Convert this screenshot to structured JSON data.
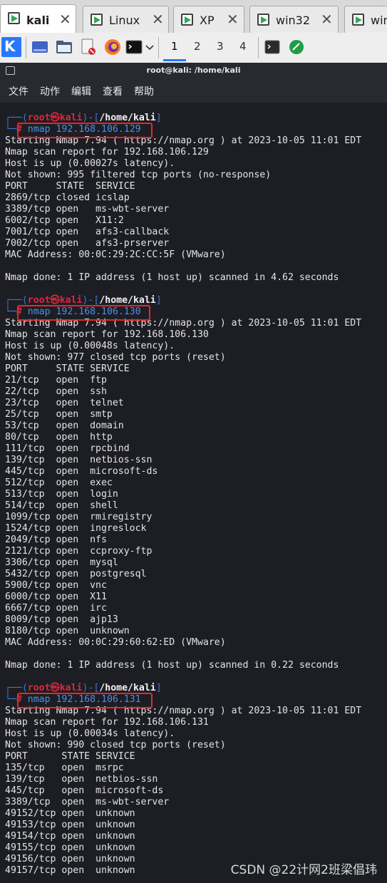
{
  "tabs": [
    {
      "label": "kali",
      "close": "✕",
      "active": true
    },
    {
      "label": "Linux",
      "close": "✕",
      "active": false
    },
    {
      "label": "XP",
      "close": "✕",
      "active": false
    },
    {
      "label": "win32",
      "close": "✕",
      "active": false
    },
    {
      "label": "win",
      "close": "",
      "active": false
    }
  ],
  "panel": {
    "workspaces": [
      "1",
      "2",
      "3",
      "4"
    ],
    "active_workspace": "1"
  },
  "terminal": {
    "title": "root@kali: /home/kali",
    "menu": [
      "文件",
      "动作",
      "编辑",
      "查看",
      "帮助"
    ]
  },
  "prompt": {
    "open": "┌──(",
    "user": "root㉿kali",
    "mid": ")-[",
    "path": "/home/kali",
    "close": "]",
    "second": "└─",
    "hash": "#"
  },
  "scans": [
    {
      "command": "nmap 192.168.106.129",
      "output": [
        "Starting Nmap 7.94 ( https://nmap.org ) at 2023-10-05 11:01 EDT",
        "Nmap scan report for 192.168.106.129",
        "Host is up (0.00027s latency).",
        "Not shown: 995 filtered tcp ports (no-response)",
        "PORT     STATE  SERVICE",
        "2869/tcp closed icslap",
        "3389/tcp open   ms-wbt-server",
        "6002/tcp open   X11:2",
        "7001/tcp open   afs3-callback",
        "7002/tcp open   afs3-prserver",
        "MAC Address: 00:0C:29:2C:CC:5F (VMware)",
        "",
        "Nmap done: 1 IP address (1 host up) scanned in 4.62 seconds"
      ]
    },
    {
      "command": "nmap 192.168.106.130",
      "output": [
        "Starting Nmap 7.94 ( https://nmap.org ) at 2023-10-05 11:01 EDT",
        "Nmap scan report for 192.168.106.130",
        "Host is up (0.00048s latency).",
        "Not shown: 977 closed tcp ports (reset)",
        "PORT     STATE SERVICE",
        "21/tcp   open  ftp",
        "22/tcp   open  ssh",
        "23/tcp   open  telnet",
        "25/tcp   open  smtp",
        "53/tcp   open  domain",
        "80/tcp   open  http",
        "111/tcp  open  rpcbind",
        "139/tcp  open  netbios-ssn",
        "445/tcp  open  microsoft-ds",
        "512/tcp  open  exec",
        "513/tcp  open  login",
        "514/tcp  open  shell",
        "1099/tcp open  rmiregistry",
        "1524/tcp open  ingreslock",
        "2049/tcp open  nfs",
        "2121/tcp open  ccproxy-ftp",
        "3306/tcp open  mysql",
        "5432/tcp open  postgresql",
        "5900/tcp open  vnc",
        "6000/tcp open  X11",
        "6667/tcp open  irc",
        "8009/tcp open  ajp13",
        "8180/tcp open  unknown",
        "MAC Address: 00:0C:29:60:62:ED (VMware)",
        "",
        "Nmap done: 1 IP address (1 host up) scanned in 0.22 seconds"
      ]
    },
    {
      "command": "nmap 192.168.106.131",
      "output": [
        "Starting Nmap 7.94 ( https://nmap.org ) at 2023-10-05 11:01 EDT",
        "Nmap scan report for 192.168.106.131",
        "Host is up (0.00034s latency).",
        "Not shown: 990 closed tcp ports (reset)",
        "PORT      STATE SERVICE",
        "135/tcp   open  msrpc",
        "139/tcp   open  netbios-ssn",
        "445/tcp   open  microsoft-ds",
        "3389/tcp  open  ms-wbt-server",
        "49152/tcp open  unknown",
        "49153/tcp open  unknown",
        "49154/tcp open  unknown",
        "49155/tcp open  unknown",
        "49156/tcp open  unknown",
        "49157/tcp open  unknown"
      ]
    }
  ],
  "watermark": "CSDN @22计网2班梁倡玮",
  "colors": {
    "prompt_frame": "#3f73d8",
    "prompt_user": "#e0263d",
    "command": "#4f8fe8",
    "highlight_box": "#e8262b"
  }
}
